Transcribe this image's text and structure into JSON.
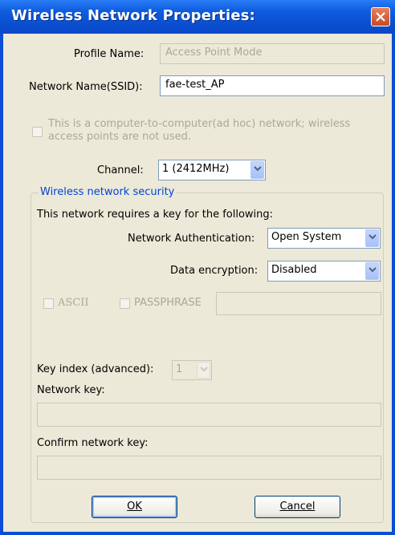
{
  "window": {
    "title": "Wireless Network Properties:"
  },
  "profile": {
    "label": "Profile Name:",
    "value": "Access Point Mode"
  },
  "ssid": {
    "label": "Network Name(SSID):",
    "value": "fae-test_AP"
  },
  "adhoc": {
    "line1": "This is a computer-to-computer(ad hoc) network; wireless",
    "line2": "access points are not used."
  },
  "channel": {
    "label": "Channel:",
    "value": "1  (2412MHz)"
  },
  "security": {
    "group_title": "Wireless network security",
    "intro": "This network requires a key for the following:",
    "auth_label": "Network Authentication:",
    "auth_value": "Open System",
    "enc_label": "Data encryption:",
    "enc_value": "Disabled",
    "ascii_label": "ASCII",
    "passphrase_label": "PASSPHRASE",
    "key_index_label": "Key index (advanced):",
    "key_index_value": "1",
    "network_key_label": "Network key:",
    "confirm_key_label": "Confirm network key:"
  },
  "buttons": {
    "ok": "OK",
    "cancel": "Cancel"
  },
  "colors": {
    "titlebar": "#0a4ed6",
    "client": "#ece9d8",
    "group_title": "#0046d5",
    "close": "#c84b22"
  }
}
